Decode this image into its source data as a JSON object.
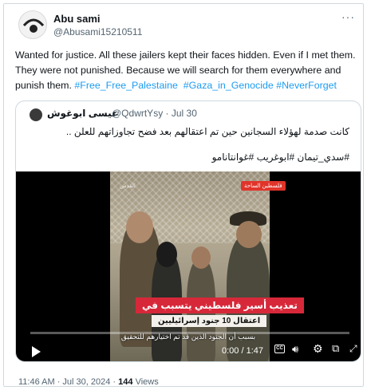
{
  "tweet": {
    "author_name": "Abu sami",
    "author_handle": "@Abusami15210511",
    "more_icon": "more-horizontal-icon",
    "text_plain": "Wanted for justice. All these jailers kept their faces hidden. Even if I met them. They were not punished. Because we will search for them everywhere and punish them. ",
    "hashtags": [
      "#Free_Free_Palestaine",
      "#Gaza_in_Genocide",
      "#NeverForget"
    ],
    "timestamp": "11:46 AM · Jul 30, 2024 · ",
    "views_count": "144",
    "views_label": " Views"
  },
  "quote": {
    "author_name": "عيسى ابوغوش",
    "author_handle": "@QdwrtYsy · Jul 30",
    "text": "كانت صدمة لهؤلاء السجانين حين تم اعتقالهم بعد فضح تجاوزاتهم للعلن ..",
    "hashtags": "#سدي_تيمان #ابوغريب #غوانتانامو"
  },
  "video": {
    "channel_badge": "فلسطين الساحة",
    "watermark": "القدس",
    "caption_main": "تعذيب أسير فلسطيني يتسبب في",
    "caption_sub": "اعتقال 10 جنود إسرائيليين",
    "subtitle": "بسبب أن الجنود الذين قد تم اختيارهم للتحقيق",
    "time_display": "0:00 / 1:47",
    "progress": 0.0,
    "icons": {
      "play": "play-icon",
      "cc": "captions-icon",
      "volume": "volume-icon",
      "settings": "gear-icon",
      "pip": "picture-in-picture-icon",
      "fullscreen": "fullscreen-icon"
    }
  }
}
